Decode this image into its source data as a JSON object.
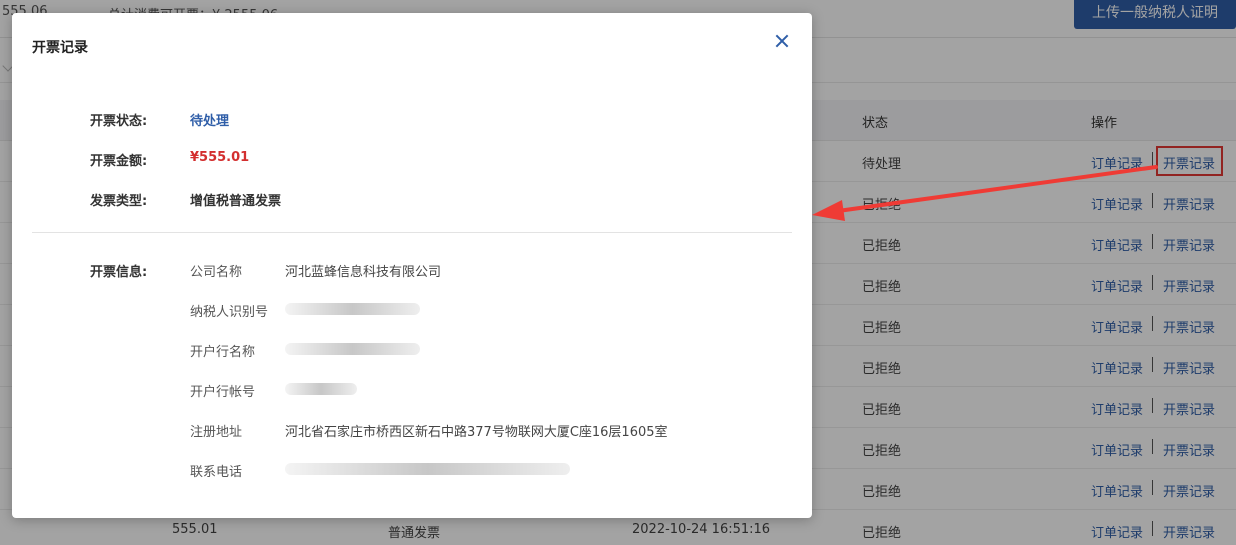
{
  "topbar": {
    "left_value": "555.06",
    "mid_text": "总计消费可开票：¥ 2555.06",
    "upload_button": "上传一般纳税人证明"
  },
  "table": {
    "headers": {
      "status": "状态",
      "ops": "操作"
    },
    "op_order": "订单记录",
    "op_invoice": "开票记录",
    "rows": [
      {
        "status": "待处理"
      },
      {
        "status": "已拒绝"
      },
      {
        "status": "已拒绝"
      },
      {
        "status": "已拒绝"
      },
      {
        "status": "已拒绝"
      },
      {
        "status": "已拒绝"
      },
      {
        "status": "已拒绝"
      },
      {
        "status": "已拒绝"
      },
      {
        "status": "已拒绝"
      },
      {
        "status": "已拒绝",
        "amount": "555.01",
        "type": "普通发票",
        "time": "2022-10-24 16:51:16"
      }
    ]
  },
  "modal": {
    "title": "开票记录",
    "status_label": "开票状态:",
    "status_value": "待处理",
    "amount_label": "开票金额:",
    "amount_value": "¥555.01",
    "type_label": "发票类型:",
    "type_value": "增值税普通发票",
    "info_label": "开票信息:",
    "info": {
      "company_key": "公司名称",
      "company_value": "河北蓝蜂信息科技有限公司",
      "taxid_key": "纳税人识别号",
      "bank_key": "开户行名称",
      "account_key": "开户行帐号",
      "address_key": "注册地址",
      "address_value": "河北省石家庄市桥西区新石中路377号物联网大厦C座16层1605室",
      "phone_key": "联系电话"
    }
  },
  "colors": {
    "accent": "#2f5ea8",
    "danger": "#d32f2f",
    "highlight": "#e53935"
  }
}
